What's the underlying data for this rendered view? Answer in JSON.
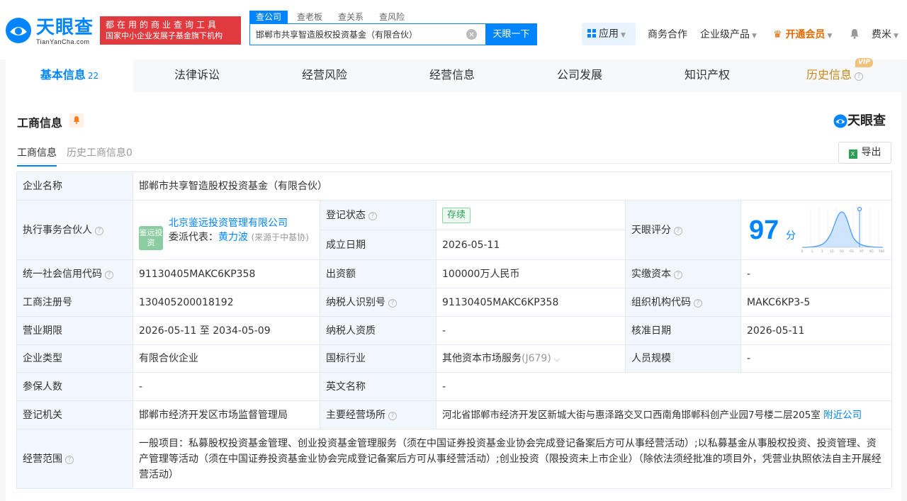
{
  "header": {
    "logo_cn": "天眼查",
    "logo_en": "TianYanCha.com",
    "slogan_line1": "都在用的商业查询工具",
    "slogan_line2": "国家中小企业发展子基金旗下机构",
    "search_tabs": [
      "查公司",
      "查老板",
      "查关系",
      "查风险"
    ],
    "search_value": "邯郸市共享智造股权投资基金（有限合伙）",
    "search_button": "天眼一下",
    "apps": "应用",
    "business": "商务合作",
    "enterprise": "企业级产品",
    "vip": "开通会员",
    "user": "费米"
  },
  "tabs": [
    {
      "label": "基本信息",
      "count": "22"
    },
    {
      "label": "法律诉讼"
    },
    {
      "label": "经营风险"
    },
    {
      "label": "经营信息"
    },
    {
      "label": "公司发展"
    },
    {
      "label": "知识产权"
    },
    {
      "label": "历史信息",
      "badge": "VIP"
    }
  ],
  "section": {
    "title": "工商信息",
    "brand": "天眼查",
    "sub_tabs": [
      "工商信息",
      "历史工商信息0"
    ],
    "export": "导出"
  },
  "info": {
    "company_name_label": "企业名称",
    "company_name": "邯郸市共享智造股权投资基金（有限合伙）",
    "partner_label": "执行事务合伙人",
    "partner_logo": "鉴远投资",
    "partner_name": "北京鉴远投资管理有限公司",
    "delegate_label": "委派代表：",
    "delegate_name": "黄力波",
    "delegate_source": "(来源于中基协)",
    "reg_status_label": "登记状态",
    "reg_status": "存续",
    "found_date_label": "成立日期",
    "found_date": "2026-05-11",
    "score_label": "天眼评分",
    "score": "97",
    "score_unit": "分",
    "credit_code_label": "统一社会信用代码",
    "credit_code": "91130405MAKC6KP358",
    "capital_label": "出资额",
    "capital": "100000万人民币",
    "paid_capital_label": "实缴资本",
    "paid_capital": "-",
    "reg_no_label": "工商注册号",
    "reg_no": "130405200018192",
    "taxpayer_id_label": "纳税人识别号",
    "taxpayer_id": "91130405MAKC6KP358",
    "org_code_label": "组织机构代码",
    "org_code": "MAKC6KP3-5",
    "term_label": "营业期限",
    "term": "2026-05-11 至 2034-05-09",
    "taxpayer_qual_label": "纳税人资质",
    "taxpayer_qual": "-",
    "approve_date_label": "核准日期",
    "approve_date": "2026-05-11",
    "type_label": "企业类型",
    "type": "有限合伙企业",
    "industry_label": "国标行业",
    "industry": "其他资本市场服务",
    "industry_code": "(J679)",
    "staff_label": "人员规模",
    "staff": "-",
    "insured_label": "参保人数",
    "insured": "-",
    "en_name_label": "英文名称",
    "en_name": "-",
    "authority_label": "登记机关",
    "authority": "邯郸市经济开发区市场监督管理局",
    "address_label": "主要经营场所",
    "address": "河北省邯郸市经济开发区新城大街与惠泽路交叉口西南角邯郸科创产业园7号楼二层205室",
    "nearby": "附近公司",
    "scope_label": "经营范围",
    "scope": "一般项目：私募股权投资基金管理、创业投资基金管理服务（须在中国证券投资基金业协会完成登记备案后方可从事经营活动）;以私募基金从事股权投资、投资管理、资产管理等活动（须在中国证券投资基金业协会完成登记备案后方可从事经营活动）;创业投资（限投资未上市企业）（除依法须经批准的项目外，凭营业执照依法自主开展经营活动）"
  },
  "score_chart": {
    "ticks": [
      "0",
      "1",
      "3",
      "15",
      "50",
      "65",
      "97",
      "85",
      "100"
    ],
    "marker": 97
  },
  "colors": {
    "accent": "#0084ff",
    "slogan_bg": "#e0393e",
    "vip": "#e36a00",
    "status_green": "#29a358"
  }
}
